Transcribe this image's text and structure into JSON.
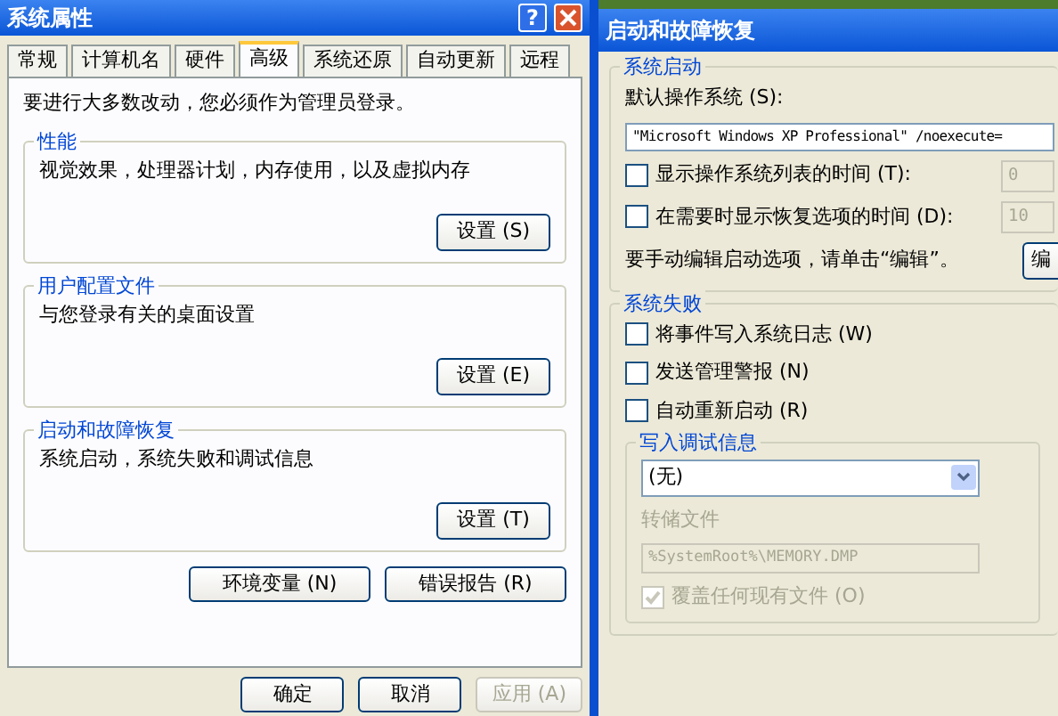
{
  "system_properties": {
    "title": "系统属性",
    "help_button": "?",
    "tabs": [
      {
        "label": "常规",
        "selected": false
      },
      {
        "label": "计算机名",
        "selected": false
      },
      {
        "label": "硬件",
        "selected": false
      },
      {
        "label": "高级",
        "selected": true
      },
      {
        "label": "系统还原",
        "selected": false
      },
      {
        "label": "自动更新",
        "selected": false
      },
      {
        "label": "远程",
        "selected": false
      }
    ],
    "admin_note": "要进行大多数改动，您必须作为管理员登录。",
    "groups": [
      {
        "title": "性能",
        "description": "视觉效果，处理器计划，内存使用，以及虚拟内存",
        "button": "设置 (S)"
      },
      {
        "title": "用户配置文件",
        "description": "与您登录有关的桌面设置",
        "button": "设置 (E)"
      },
      {
        "title": "启动和故障恢复",
        "description": "系统启动，系统失败和调试信息",
        "button": "设置 (T)"
      }
    ],
    "extra_buttons": [
      "环境变量 (N)",
      "错误报告 (R)"
    ],
    "dialog_buttons": [
      {
        "label": "确定",
        "disabled": false
      },
      {
        "label": "取消",
        "disabled": false
      },
      {
        "label": "应用 (A)",
        "disabled": true
      }
    ]
  },
  "startup_recovery": {
    "title": "启动和故障恢复",
    "system_startup": {
      "title": "系统启动",
      "default_os_label": "默认操作系统 (S):",
      "default_os": "\"Microsoft Windows XP Professional\" /noexecute=",
      "timers": [
        {
          "label": "显示操作系统列表的时间 (T):",
          "checked": false,
          "value": "0",
          "disabled": true
        },
        {
          "label": "在需要时显示恢复选项的时间 (D):",
          "checked": false,
          "value": "10",
          "disabled": true
        }
      ],
      "edit_note": "要手动编辑启动选项，请单击“编辑”。",
      "edit_button": "编"
    },
    "system_failure": {
      "title": "系统失败",
      "options": [
        {
          "label": "将事件写入系统日志 (W)",
          "checked": false
        },
        {
          "label": "发送管理警报 (N)",
          "checked": false
        },
        {
          "label": "自动重新启动 (R)",
          "checked": false
        }
      ],
      "debug": {
        "title": "写入调试信息",
        "selected": "(无)",
        "dump_file_label": "转储文件",
        "dump_file": "%SystemRoot%\\MEMORY.DMP",
        "disabled": true,
        "overwrite": {
          "label": "覆盖任何现有文件 (O)",
          "checked": true
        }
      }
    }
  }
}
